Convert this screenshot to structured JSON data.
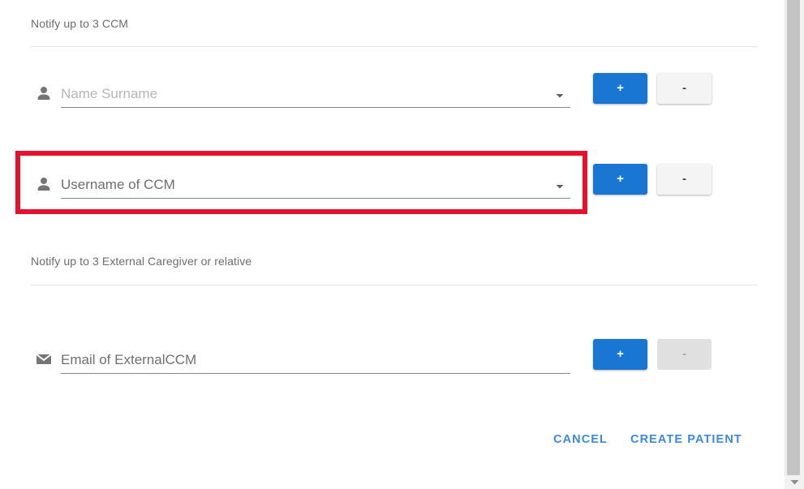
{
  "dialog": {
    "sections": [
      {
        "id": "ccm",
        "label": "Notify up to 3 CCM"
      },
      {
        "id": "external",
        "label": "Notify up to 3 External Caregiver or relative"
      }
    ],
    "fields": [
      {
        "id": "ccm-name",
        "icon": "person-icon",
        "placeholder": "Name Surname",
        "value": "",
        "state": "empty",
        "has_dropdown": true,
        "add_label": "+",
        "remove_label": "-",
        "remove_disabled": false
      },
      {
        "id": "ccm-username",
        "icon": "person-icon",
        "placeholder": "Username of CCM",
        "value": "",
        "state": "focused",
        "has_dropdown": true,
        "add_label": "+",
        "remove_label": "-",
        "remove_disabled": false
      },
      {
        "id": "external-email",
        "icon": "email-icon",
        "placeholder": "Email of ExternalCCM",
        "value": "",
        "state": "empty",
        "has_dropdown": false,
        "add_label": "+",
        "remove_label": "-",
        "remove_disabled": true
      }
    ],
    "actions": {
      "cancel_label": "CANCEL",
      "submit_label": "CREATE PATIENT"
    }
  },
  "annotation": {
    "type": "highlight-rectangle",
    "color": "#e8112d",
    "target": "ccm-username"
  },
  "colors": {
    "accent_blue": "#1976d2",
    "link_blue": "#3b8ae2",
    "highlight_red": "#e8112d",
    "placeholder_gray": "#b6b6b6",
    "text_gray": "#6d6d6d",
    "divider_gray": "#e6e6e6"
  },
  "scrollbar": {
    "orientation": "vertical",
    "down_arrow": "triangle-down-icon"
  }
}
